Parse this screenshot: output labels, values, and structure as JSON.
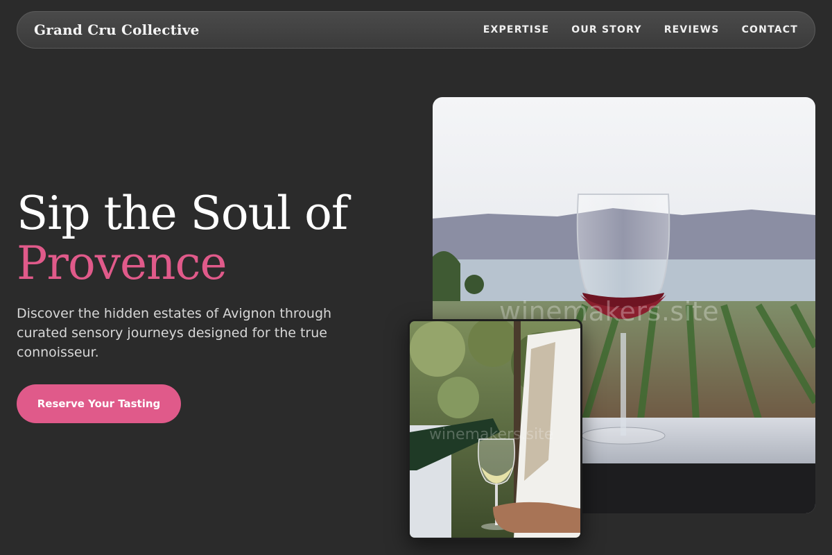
{
  "nav": {
    "brand": "Grand Cru Collective",
    "links": [
      "EXPERTISE",
      "OUR STORY",
      "REVIEWS",
      "CONTACT"
    ]
  },
  "hero": {
    "title_line1": "Sip the Soul of",
    "title_line2": "Provence",
    "subtitle": "Discover the hidden estates of Avignon through curated sensory journeys designed for the true connoisseur.",
    "cta_label": "Reserve Your Tasting"
  },
  "images": {
    "main_watermark": "winemakers.site",
    "small_watermark": "winemakers.site"
  },
  "colors": {
    "background": "#2b2b2b",
    "accent": "#e05a8a",
    "text": "#ffffff"
  }
}
